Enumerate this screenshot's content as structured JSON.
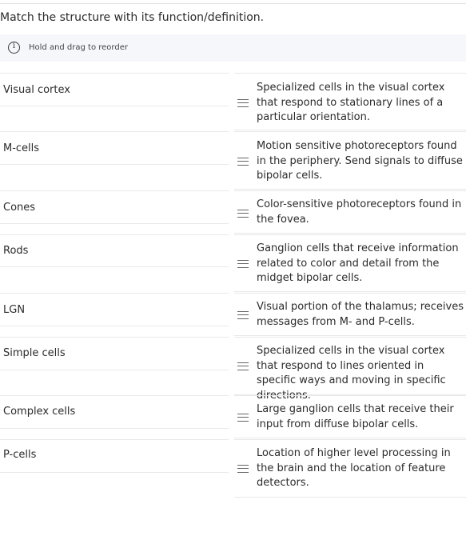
{
  "instruction": "Match the structure with its function/definition.",
  "hint": {
    "icon": "info-circle-icon",
    "text": "Hold and drag to reorder"
  },
  "structures": [
    "Visual cortex",
    "M-cells",
    "Cones",
    "Rods",
    "LGN",
    "Simple cells",
    "Complex cells",
    "P-cells"
  ],
  "definitions": [
    "Specialized cells in the visual cortex that respond to stationary lines of a particular orientation.",
    "Motion sensitive photoreceptors found in the periphery. Send signals to diffuse bipolar cells.",
    "Color-sensitive photoreceptors found in the fovea.",
    "Ganglion cells that receive information related to color and detail from the midget bipolar cells.",
    "Visual portion of the thalamus; receives messages from M- and P-cells.",
    "Specialized cells in the visual cortex that respond to lines oriented in specific ways and moving in specific directions.",
    "Large ganglion cells that receive their input from diffuse bipolar cells.",
    "Location of higher level processing in the brain and the location of feature detectors."
  ]
}
